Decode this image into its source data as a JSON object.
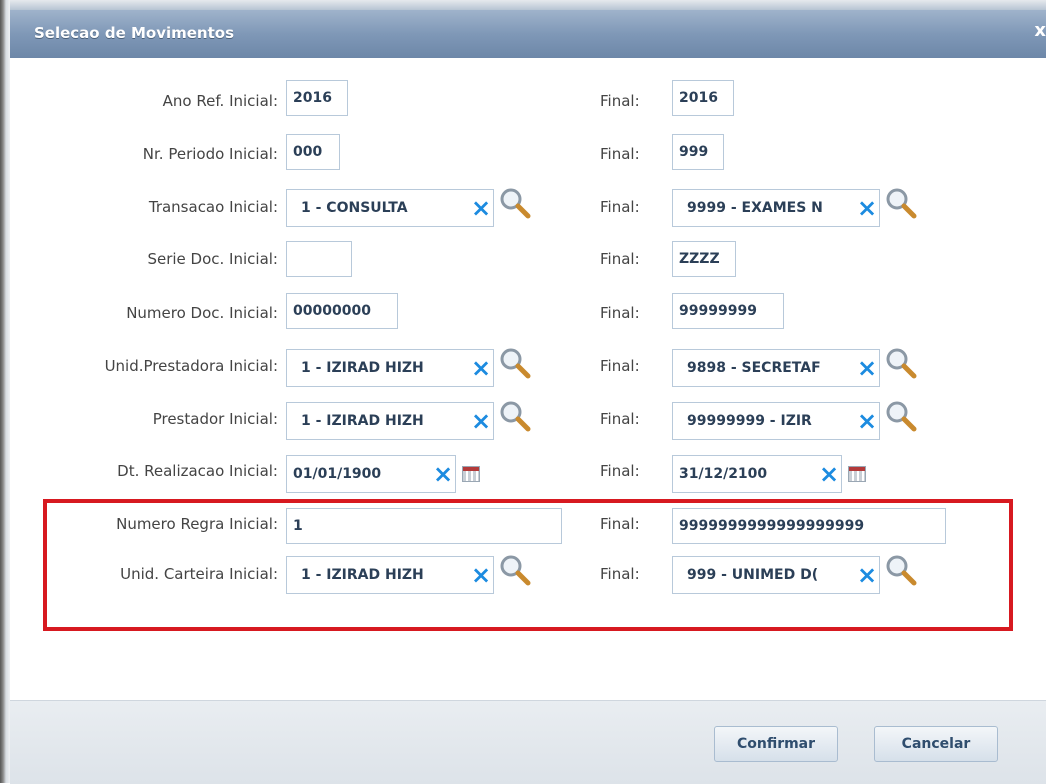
{
  "dialog": {
    "title": "Selecao de Movimentos",
    "close": "x"
  },
  "rows": [
    {
      "label": "Ano Ref. Inicial:",
      "start": "2016",
      "final_label": "Final:",
      "end": "2016"
    },
    {
      "label": "Nr. Periodo Inicial:",
      "start": "000",
      "final_label": "Final:",
      "end": "999"
    },
    {
      "label": "Transacao Inicial:",
      "start": "1 - CONSULTA",
      "final_label": "Final:",
      "end": "9999 - EXAMES N"
    },
    {
      "label": "Serie Doc. Inicial:",
      "start": "",
      "final_label": "Final:",
      "end": "ZZZZ"
    },
    {
      "label": "Numero Doc. Inicial:",
      "start": "00000000",
      "final_label": "Final:",
      "end": "99999999"
    },
    {
      "label": "Unid.Prestadora Inicial:",
      "start": "1 - IZIRAD HIZH",
      "final_label": "Final:",
      "end": "9898 - SECRETAF"
    },
    {
      "label": "Prestador Inicial:",
      "start": "1 - IZIRAD HIZH",
      "final_label": "Final:",
      "end": "99999999 - IZIR"
    },
    {
      "label": "Dt. Realizacao Inicial:",
      "start": "01/01/1900",
      "final_label": "Final:",
      "end": "31/12/2100"
    },
    {
      "label": "Numero Regra Inicial:",
      "start": "1",
      "final_label": "Final:",
      "end": "9999999999999999999"
    },
    {
      "label": "Unid. Carteira Inicial:",
      "start": "1 - IZIRAD HIZH",
      "final_label": "Final:",
      "end": "999 - UNIMED D("
    }
  ],
  "icons": {
    "clear": "×",
    "lookup": "magnifier-icon",
    "calendar": "calendar-icon"
  },
  "buttons": {
    "confirm": "Confirmar",
    "cancel": "Cancelar"
  },
  "colors": {
    "title_bg": "#7f98b7",
    "clear_icon": "#1c8be0",
    "highlight_border": "#d71920"
  }
}
